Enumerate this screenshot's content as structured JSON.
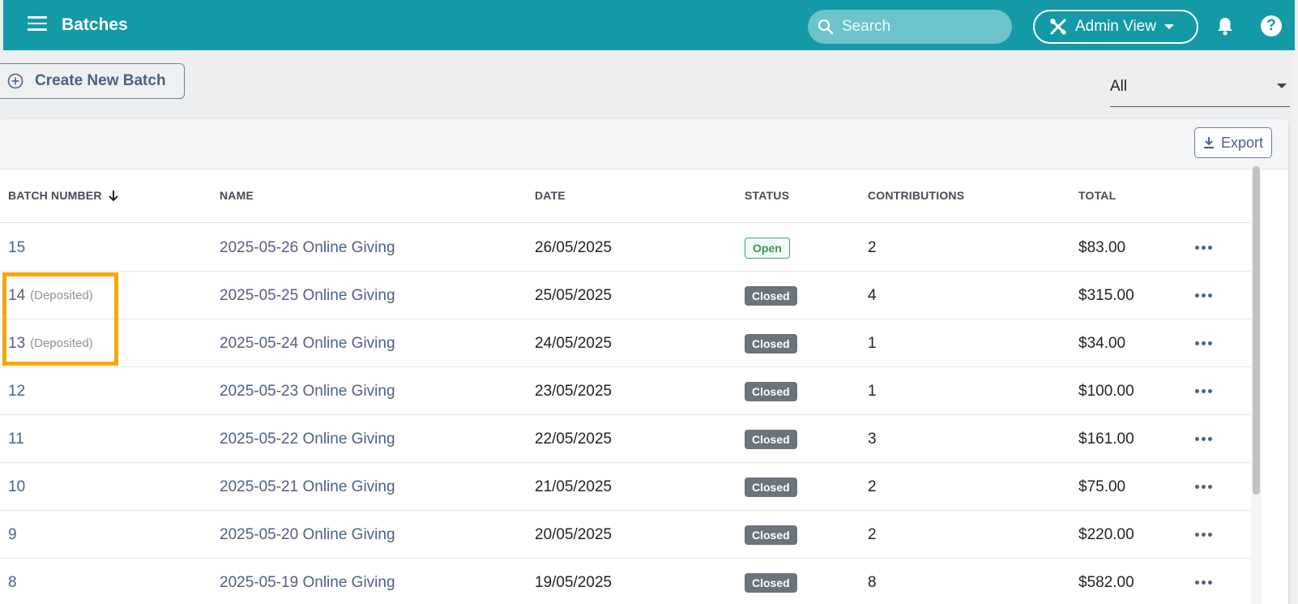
{
  "header": {
    "title": "Batches",
    "search_placeholder": "Search",
    "admin_view_label": "Admin View"
  },
  "toolbar": {
    "create_label": "Create New Batch",
    "filter_value": "All",
    "export_label": "Export"
  },
  "table": {
    "columns": [
      "BATCH NUMBER",
      "NAME",
      "DATE",
      "STATUS",
      "CONTRIBUTIONS",
      "TOTAL"
    ],
    "rows": [
      {
        "number": "15",
        "deposited": "",
        "name": "2025-05-26 Online Giving",
        "date": "26/05/2025",
        "status": "Open",
        "contributions": "2",
        "total": "$83.00"
      },
      {
        "number": "14",
        "deposited": "(Deposited)",
        "name": "2025-05-25 Online Giving",
        "date": "25/05/2025",
        "status": "Closed",
        "contributions": "4",
        "total": "$315.00"
      },
      {
        "number": "13",
        "deposited": "(Deposited)",
        "name": "2025-05-24 Online Giving",
        "date": "24/05/2025",
        "status": "Closed",
        "contributions": "1",
        "total": "$34.00"
      },
      {
        "number": "12",
        "deposited": "",
        "name": "2025-05-23 Online Giving",
        "date": "23/05/2025",
        "status": "Closed",
        "contributions": "1",
        "total": "$100.00"
      },
      {
        "number": "11",
        "deposited": "",
        "name": "2025-05-22 Online Giving",
        "date": "22/05/2025",
        "status": "Closed",
        "contributions": "3",
        "total": "$161.00"
      },
      {
        "number": "10",
        "deposited": "",
        "name": "2025-05-21 Online Giving",
        "date": "21/05/2025",
        "status": "Closed",
        "contributions": "2",
        "total": "$75.00"
      },
      {
        "number": "9",
        "deposited": "",
        "name": "2025-05-20 Online Giving",
        "date": "20/05/2025",
        "status": "Closed",
        "contributions": "2",
        "total": "$220.00"
      },
      {
        "number": "8",
        "deposited": "",
        "name": "2025-05-19 Online Giving",
        "date": "19/05/2025",
        "status": "Closed",
        "contributions": "8",
        "total": "$582.00"
      }
    ]
  },
  "colors": {
    "header_bg": "#149aa6",
    "link": "#4b6384",
    "open_badge": "#2e9a53",
    "closed_badge": "#6b737c",
    "highlight": "#f5a800"
  },
  "icons": [
    "menu-icon",
    "search-icon",
    "tools-icon",
    "chevron-down-icon",
    "bell-icon",
    "help-icon",
    "plus-circle-icon",
    "download-icon",
    "arrow-down-icon",
    "more-icon"
  ]
}
